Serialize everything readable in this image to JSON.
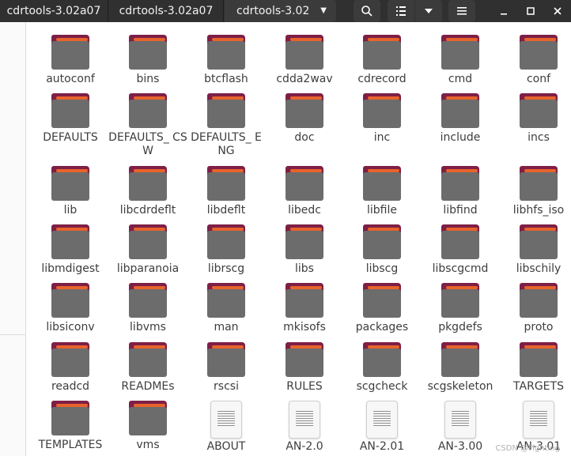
{
  "header": {
    "crumbs": [
      "cdrtools-3.02a07",
      "cdrtools-3.02a07",
      "cdrtools-3.02"
    ],
    "icons": [
      "search-icon",
      "list-view-icon",
      "chevron-down-icon",
      "hamburger-menu-icon",
      "minimize-icon",
      "maximize-icon",
      "close-icon"
    ]
  },
  "items": [
    {
      "label": "autoconf",
      "type": "folder"
    },
    {
      "label": "bins",
      "type": "folder"
    },
    {
      "label": "btcflash",
      "type": "folder"
    },
    {
      "label": "cdda2wav",
      "type": "folder"
    },
    {
      "label": "cdrecord",
      "type": "folder"
    },
    {
      "label": "cmd",
      "type": "folder"
    },
    {
      "label": "conf",
      "type": "folder"
    },
    {
      "label": "DEFAULTS",
      "type": "folder"
    },
    {
      "label": "DEFAULTS_ CSW",
      "type": "folder"
    },
    {
      "label": "DEFAULTS_ ENG",
      "type": "folder"
    },
    {
      "label": "doc",
      "type": "folder"
    },
    {
      "label": "inc",
      "type": "folder"
    },
    {
      "label": "include",
      "type": "folder"
    },
    {
      "label": "incs",
      "type": "folder"
    },
    {
      "label": "lib",
      "type": "folder"
    },
    {
      "label": "libcdrdeflt",
      "type": "folder"
    },
    {
      "label": "libdeflt",
      "type": "folder"
    },
    {
      "label": "libedc",
      "type": "folder"
    },
    {
      "label": "libfile",
      "type": "folder"
    },
    {
      "label": "libfind",
      "type": "folder"
    },
    {
      "label": "libhfs_iso",
      "type": "folder"
    },
    {
      "label": "libmdigest",
      "type": "folder"
    },
    {
      "label": "libparanoia",
      "type": "folder"
    },
    {
      "label": "librscg",
      "type": "folder"
    },
    {
      "label": "libs",
      "type": "folder"
    },
    {
      "label": "libscg",
      "type": "folder"
    },
    {
      "label": "libscgcmd",
      "type": "folder"
    },
    {
      "label": "libschily",
      "type": "folder"
    },
    {
      "label": "libsiconv",
      "type": "folder"
    },
    {
      "label": "libvms",
      "type": "folder"
    },
    {
      "label": "man",
      "type": "folder"
    },
    {
      "label": "mkisofs",
      "type": "folder"
    },
    {
      "label": "packages",
      "type": "folder"
    },
    {
      "label": "pkgdefs",
      "type": "folder"
    },
    {
      "label": "proto",
      "type": "folder"
    },
    {
      "label": "readcd",
      "type": "folder"
    },
    {
      "label": "READMEs",
      "type": "folder"
    },
    {
      "label": "rscsi",
      "type": "folder"
    },
    {
      "label": "RULES",
      "type": "folder"
    },
    {
      "label": "scgcheck",
      "type": "folder"
    },
    {
      "label": "scgskeleton",
      "type": "folder"
    },
    {
      "label": "TARGETS",
      "type": "folder"
    },
    {
      "label": "TEMPLATES",
      "type": "folder"
    },
    {
      "label": "vms",
      "type": "folder"
    },
    {
      "label": "ABOUT",
      "type": "file"
    },
    {
      "label": "AN-2.0",
      "type": "file"
    },
    {
      "label": "AN-2.01",
      "type": "file"
    },
    {
      "label": "AN-3.00",
      "type": "file"
    },
    {
      "label": "AN-3.01",
      "type": "file"
    }
  ],
  "watermark": "CSDN @Fighting"
}
